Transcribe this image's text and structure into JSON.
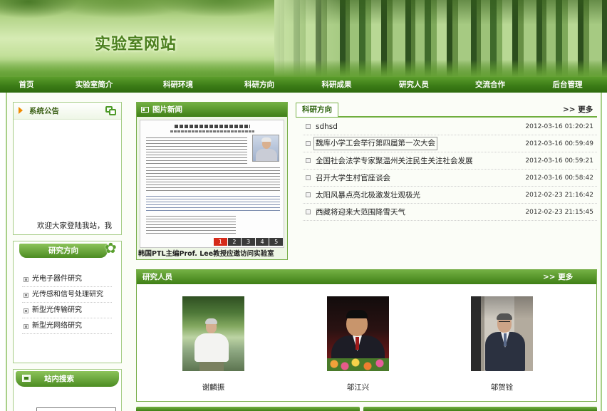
{
  "site": {
    "title": "实验室网站"
  },
  "nav": {
    "items": [
      {
        "label": "首页"
      },
      {
        "label": "实验室简介"
      },
      {
        "label": "科研环境"
      },
      {
        "label": "科研方向"
      },
      {
        "label": "科研成果"
      },
      {
        "label": "研究人员"
      },
      {
        "label": "交流合作"
      },
      {
        "label": "后台管理"
      }
    ]
  },
  "notice": {
    "title": "系统公告",
    "text": "欢迎大家登陆我站，我",
    "arrow_icon": "triangle-right-icon",
    "icon": "notice-windows-icon"
  },
  "research_sidebar": {
    "title": "研究方向",
    "icon": "flower-icon",
    "items": [
      {
        "label": "光电子器件研究"
      },
      {
        "label": "光传感和信号处理研究"
      },
      {
        "label": "新型光传输研究"
      },
      {
        "label": "新型光网络研究"
      }
    ]
  },
  "search": {
    "title": "站内搜索",
    "icon": "search-box-icon",
    "keyword": ""
  },
  "photo_news": {
    "title": "图片新闻",
    "icon": "picture-icon",
    "caption": "韩国PTL主编Prof. Lee教授应邀访问实验室",
    "pages": [
      "1",
      "2",
      "3",
      "4",
      "5"
    ],
    "active_page_index": 0
  },
  "research_news": {
    "tab": "科研方向",
    "more": ">> 更多",
    "items": [
      {
        "title": "sdhsd",
        "date": "2012-03-16 01:20:21"
      },
      {
        "title": "魏库小学工会举行第四届第一次大会",
        "date": "2012-03-16 00:59:49"
      },
      {
        "title": "全国社会法学专家聚温州关注民生关注社会发展",
        "date": "2012-03-16 00:59:21"
      },
      {
        "title": "召开大学生村官座谈会",
        "date": "2012-03-16 00:58:42"
      },
      {
        "title": "太阳风暴点亮北极激发壮观极光",
        "date": "2012-02-23 21:16:42"
      },
      {
        "title": "西藏将迎来大范围降雪天气",
        "date": "2012-02-23 21:15:45"
      }
    ]
  },
  "people": {
    "title": "研究人员",
    "more": ">> 更多",
    "members": [
      {
        "name": "谢麟振"
      },
      {
        "name": "邬江兴"
      },
      {
        "name": "邬贺铨"
      }
    ]
  },
  "colors": {
    "brand_green": "#3c7d17",
    "header_green": "#4c8c22",
    "title_green": "#4b7f1f",
    "active_page": "#d52a1a"
  }
}
